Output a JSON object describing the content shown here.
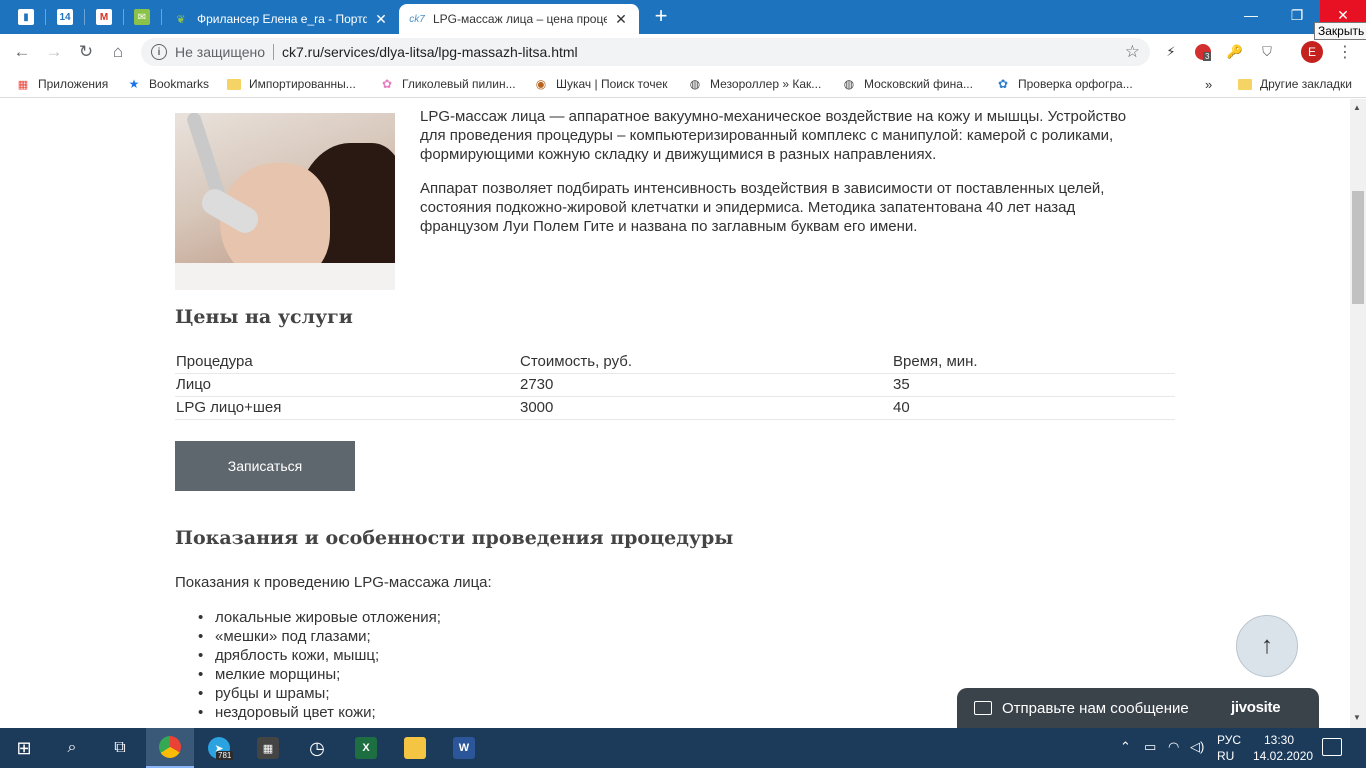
{
  "browser": {
    "tabs": [
      {
        "title": "Фрилансер Елена e_ra - Портфо"
      },
      {
        "title": "LPG-массаж лица – цена проце"
      }
    ],
    "pinned_tab_badge": "14",
    "close_tooltip": "Закрыть",
    "address": {
      "security_label": "Не защищено",
      "url": "ck7.ru/services/dlya-litsa/lpg-massazh-litsa.html"
    },
    "extension_badge": "3",
    "profile_initial": "E",
    "bookmarks": [
      {
        "label": "Приложения",
        "icon": "apps-grid-icon"
      },
      {
        "label": "Bookmarks",
        "icon": "star-icon"
      },
      {
        "label": "Импортированны...",
        "icon": "folder-icon"
      },
      {
        "label": "Гликолевый пилин...",
        "icon": "flower-icon"
      },
      {
        "label": "Шукач | Поиск точек",
        "icon": "site-icon"
      },
      {
        "label": "Мезороллер » Как...",
        "icon": "globe-icon"
      },
      {
        "label": "Московский фина...",
        "icon": "globe-icon"
      },
      {
        "label": "Проверка орфогра...",
        "icon": "flower-icon"
      }
    ],
    "other_bookmarks": "Другие закладки",
    "bookmarks_overflow": "»"
  },
  "page": {
    "intro_p1": "LPG-массаж лица — аппаратное вакуумно-механическое воздействие на кожу и мышцы. Устройство для проведения процедуры – компьютеризированный комплекс с манипулой: камерой с роликами, формирующими кожную складку и движущимися в разных направлениях.",
    "intro_p2": "Аппарат позволяет подбирать интенсивность воздействия в зависимости от поставленных целей, состояния подкожно-жировой клетчатки и эпидермиса. Методика запатентована 40 лет назад французом Луи Полем Гите и названа по заглавным буквам его имени.",
    "prices_title": "Цены на услуги",
    "price_table": {
      "headers": [
        "Процедура",
        "Стоимость, руб.",
        "Время, мин."
      ],
      "rows": [
        [
          "Лицо",
          "2730",
          "35"
        ],
        [
          "LPG лицо+шея",
          "3000",
          "40"
        ]
      ]
    },
    "book_button": "Записаться",
    "features_title": "Показания и особенности проведения процедуры",
    "indications_label": "Показания к проведению LPG-массажа лица:",
    "indications": [
      "локальные жировые отложения;",
      "«мешки» под глазами;",
      "дряблость кожи, мышц;",
      "мелкие морщины;",
      "рубцы и шрамы;",
      "нездоровый цвет кожи;"
    ],
    "chat_widget": {
      "label": "Отправьте нам сообщение",
      "brand": "jivosite"
    }
  },
  "taskbar": {
    "telegram_badge": "781",
    "lang_top": "РУС",
    "lang_bottom": "RU",
    "time": "13:30",
    "date": "14.02.2020"
  },
  "colors": {
    "tabstrip": "#1e73be",
    "button": "#5e676d",
    "taskbar": "#1c3a5a",
    "chat": "#3a424a"
  }
}
